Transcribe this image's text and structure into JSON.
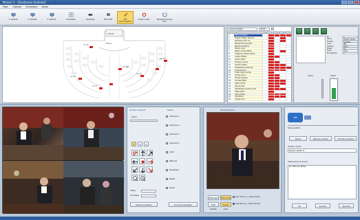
{
  "window": {
    "title": "Mozaic 2 - [Gestiunea Sedintei]"
  },
  "menu": [
    "Fișier",
    "Operare",
    "Vizualizare",
    "Ajutor"
  ],
  "toolbar": [
    {
      "label": "1. Sedinta"
    },
    {
      "label": "2. Sedinta"
    },
    {
      "label": "3. Sedinta"
    },
    {
      "label": "Vizualizare"
    },
    {
      "label": "Camerele"
    },
    {
      "label": "PTZ Audit"
    },
    {
      "label": "PTZ Supraveghere",
      "active": true
    },
    {
      "label": "Control video"
    },
    {
      "label": "Resetare Camere PTZ"
    }
  ],
  "floor": {
    "seat_labels": [
      "Prezidiu",
      "Tribuna",
      "Loc 12",
      "Loc 34",
      "Loc 57",
      "Loc 79",
      "Loc 103",
      "Loc 118"
    ]
  },
  "seats_panel": {
    "header": "Nume Delegat",
    "dropdown": "GRUP",
    "rows": [
      {
        "num": "1",
        "name": "Petrovici Mihail",
        "reds": [
          0,
          1,
          1,
          1,
          1
        ],
        "selected": true
      },
      {
        "num": "2",
        "name": "Bogdan Stefan Dumitru",
        "reds": [
          0,
          1,
          0,
          1,
          0
        ]
      },
      {
        "num": "3",
        "name": "Radulescu Dan Ion",
        "reds": [
          0,
          1,
          0,
          1,
          0
        ]
      },
      {
        "num": "4",
        "name": "Balogh Pal Gheorghe",
        "reds": [
          0,
          1,
          0,
          0,
          0
        ]
      },
      {
        "num": "5",
        "name": "Barcaczyk Tamas",
        "reds": [
          0,
          1,
          0,
          0,
          0
        ]
      },
      {
        "num": "6",
        "name": "Boeriu Lucia",
        "reds": [
          0,
          1,
          0,
          0,
          0
        ]
      },
      {
        "num": "7",
        "name": "Bekes Andras Miklos",
        "reds": [
          0,
          1,
          0,
          1,
          0
        ]
      },
      {
        "num": "8",
        "name": "Csajkovics Zoltan Tamas",
        "reds": [
          0,
          1,
          0,
          0,
          0
        ]
      },
      {
        "num": "9",
        "name": "Csiszer Mihaly",
        "reds": [
          0,
          1,
          1,
          0,
          0
        ]
      },
      {
        "num": "10",
        "name": "Danku Attila",
        "reds": [
          0,
          1,
          0,
          0,
          0
        ]
      },
      {
        "num": "11",
        "name": "Dobrescu Ioana",
        "reds": [
          0,
          1,
          1,
          0,
          0
        ]
      },
      {
        "num": "12",
        "name": "Dumitru Gabor",
        "reds": [
          0,
          1,
          1,
          1,
          0
        ]
      },
      {
        "num": "13",
        "name": "Farkashazy Andrei Ilie",
        "reds": [
          0,
          1,
          1,
          1,
          1
        ]
      },
      {
        "num": "14",
        "name": "Fogaras Lajos",
        "reds": [
          0,
          1,
          1,
          1,
          0
        ]
      },
      {
        "num": "15",
        "name": "Frater Istvan Andrei",
        "reds": [
          0,
          1,
          0,
          0,
          0
        ]
      },
      {
        "num": "16",
        "name": "Ilosvay Janos",
        "reds": [
          0,
          1,
          1,
          0,
          0
        ]
      },
      {
        "num": "17",
        "name": "Halasz Ladislau",
        "reds": [
          0,
          1,
          1,
          0,
          0
        ]
      },
      {
        "num": "18",
        "name": "Horvath Mihai",
        "reds": [
          0,
          1,
          1,
          1,
          0
        ]
      },
      {
        "num": "19",
        "name": "Kallos Tunde",
        "reds": [
          0,
          1,
          1,
          1,
          0
        ]
      },
      {
        "num": "20",
        "name": "Kiss Andras",
        "reds": [
          0,
          1,
          1,
          0,
          0
        ]
      },
      {
        "num": "21",
        "name": "Szentkiralyi Andrei Lorant",
        "reds": [
          0,
          1,
          1,
          1,
          0
        ]
      },
      {
        "num": "22",
        "name": "Szabo Petru",
        "reds": [
          0,
          1,
          0,
          0,
          0
        ]
      },
      {
        "num": "23",
        "name": "Szucs Istvan",
        "reds": [
          0,
          1,
          1,
          1,
          0
        ]
      },
      {
        "num": "24",
        "name": "Toth Mihai",
        "reds": [
          0,
          1,
          1,
          1,
          0
        ]
      },
      {
        "num": "25",
        "name": "Vecsei Anna",
        "reds": [
          0,
          1,
          0,
          0,
          0
        ]
      }
    ]
  },
  "right_panel": {
    "fields": [
      {
        "k": "Nr.",
        "v": "1"
      },
      {
        "k": "Nume",
        "v": "Bogdan Stefan D."
      },
      {
        "k": "Functie",
        "v": "Consilier"
      },
      {
        "k": "Grup",
        "v": "PNL"
      },
      {
        "k": "Camera",
        "v": "PTZ 1"
      },
      {
        "k": "Preset",
        "v": "12"
      },
      {
        "k": "Stare",
        "v": "Activ"
      },
      {
        "k": "Nr. Prezenta",
        "v": "3"
      }
    ],
    "gauge_label": "Volum",
    "gauge_level": 0.55
  },
  "controls": {
    "title": "Control manual",
    "zoom_label": "Zoom",
    "presets": [
      "1",
      "2",
      "3"
    ],
    "options_title": "Setari",
    "options": [
      "Camera 1",
      "Camera 2",
      "Camera 3",
      "Camera 4",
      "Auto",
      "Manual",
      "Presetare",
      "Reset",
      "Iesire"
    ],
    "speed_label": "Viteza",
    "focus_label": "Focalizare",
    "buttons": [
      "Salvare presetari",
      "Incarcare presetari"
    ]
  },
  "mainvid": {
    "title": "Previzualizare",
    "btn_row1": [
      "PTZ Auto",
      "PTZ Audit"
    ],
    "btn_row2": [
      "PTZ Pozitie",
      "Preset Auto"
    ],
    "radio1": "Auto: Pres. se + camera Oprita",
    "radio2": "Auto Pres. se + camera Pornita"
  },
  "form": {
    "logo": "Vot",
    "section": "Sala sedinta",
    "buttons": [
      "Pauza",
      "Reluare sedinta",
      "Inchidere sedinta"
    ],
    "field_label": "Vorbitor curent",
    "field_value": "Bogdan Stefan D.",
    "list_label": "Lista inscrisi la cuvant",
    "list_value": "01. Petrovici Mihail",
    "bottom_buttons": [
      "Ok",
      "Anulare",
      "Aplicare"
    ]
  },
  "colors": {
    "accent": "#f7d66a",
    "red": "#d92020",
    "green": "#2fa14c",
    "bg": "#c9d3de"
  }
}
